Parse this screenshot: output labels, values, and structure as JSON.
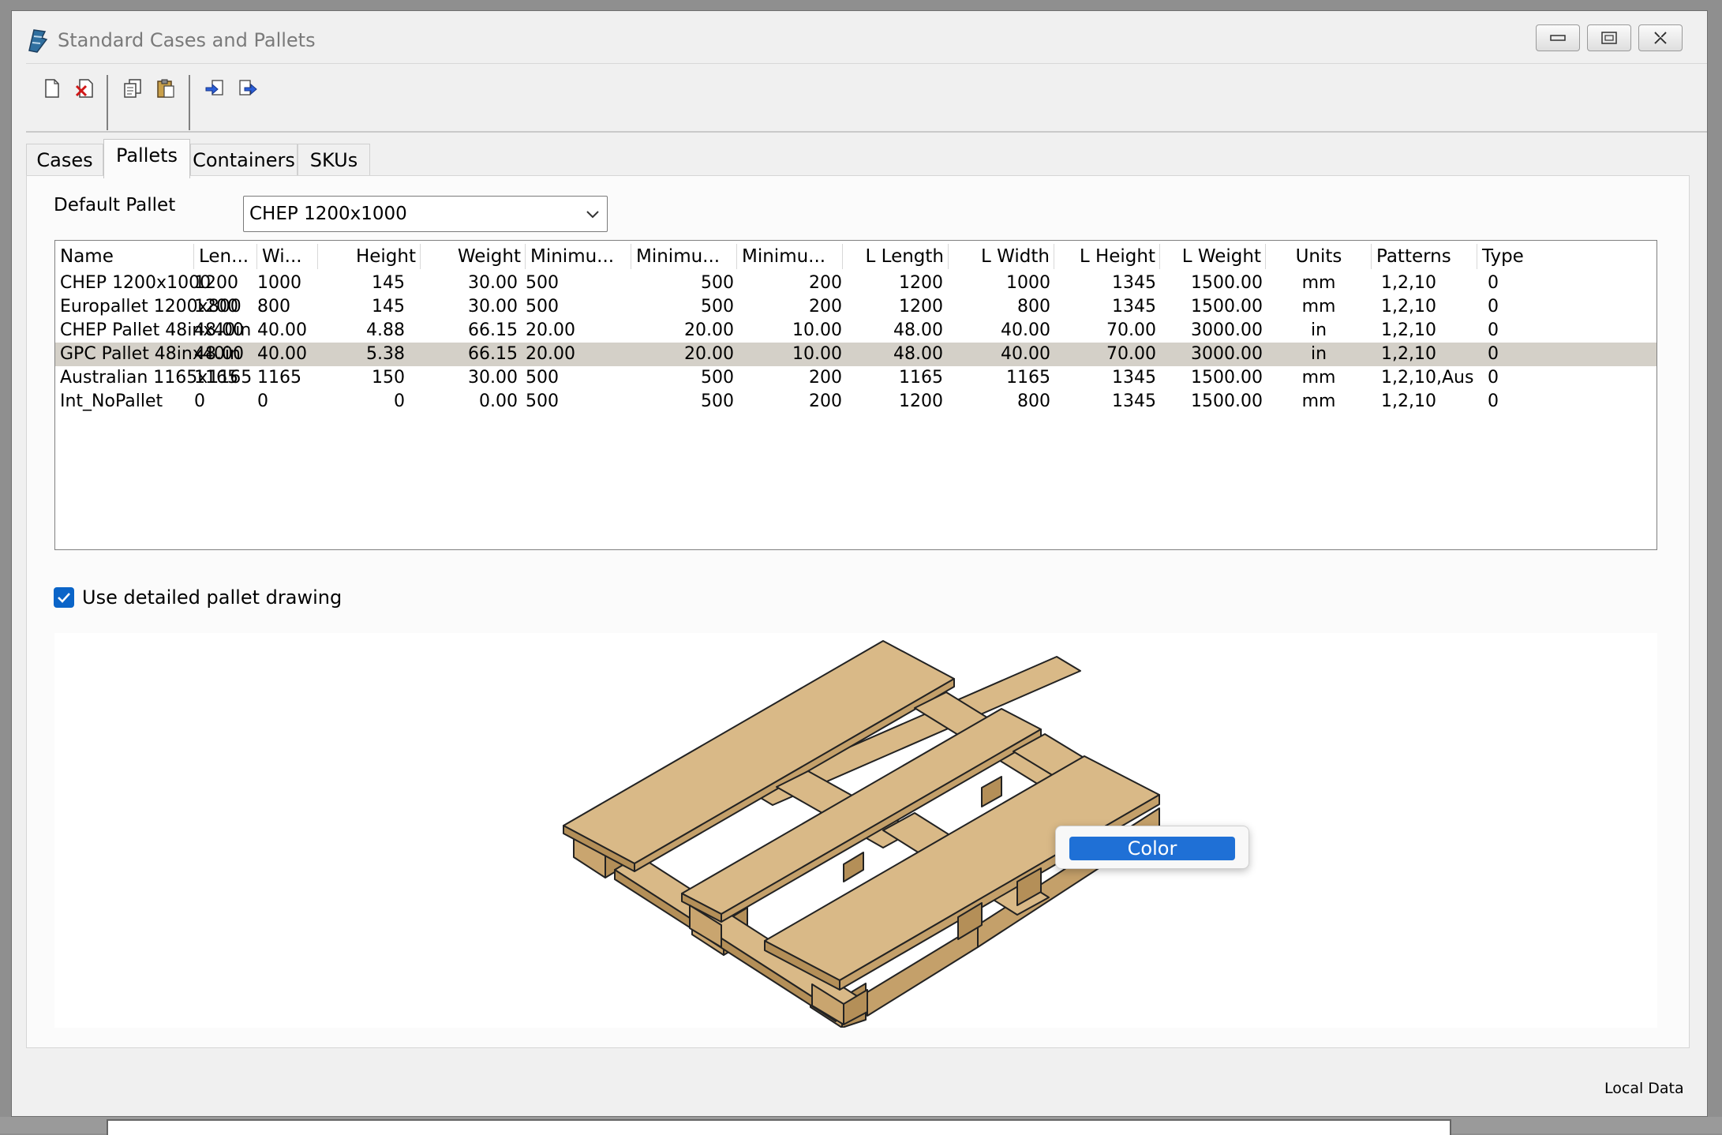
{
  "window": {
    "title": "Standard Cases and Pallets"
  },
  "toolbar": {
    "buttons": [
      {
        "name": "new-icon"
      },
      {
        "name": "delete-icon"
      },
      {
        "name": "copy-icon"
      },
      {
        "name": "paste-icon"
      },
      {
        "name": "import-icon"
      },
      {
        "name": "export-icon"
      }
    ]
  },
  "tabs": [
    {
      "label": "Cases"
    },
    {
      "label": "Pallets"
    },
    {
      "label": "Containers"
    },
    {
      "label": "SKUs"
    }
  ],
  "active_tab": "Pallets",
  "default_pallet": {
    "label": "Default Pallet",
    "value": "CHEP 1200x1000"
  },
  "table": {
    "columns": [
      "Name",
      "Len...",
      "Wi...",
      "Height",
      "Weight",
      "Minimu...",
      "Minimu...",
      "Minimu...",
      "L Length",
      "L Width",
      "L Height",
      "L Weight",
      "Units",
      "Patterns",
      "Type"
    ],
    "rows": [
      [
        "CHEP 1200x1000",
        "1200",
        "1000",
        "145",
        "30.00",
        "500",
        "500",
        "200",
        "1200",
        "1000",
        "1345",
        "1500.00",
        "mm",
        "1,2,10",
        "0"
      ],
      [
        "Europallet 1200x800",
        "1200",
        "800",
        "145",
        "30.00",
        "500",
        "500",
        "200",
        "1200",
        "800",
        "1345",
        "1500.00",
        "mm",
        "1,2,10",
        "0"
      ],
      [
        "CHEP Pallet 48inx40in",
        "48.00",
        "40.00",
        "4.88",
        "66.15",
        "20.00",
        "20.00",
        "10.00",
        "48.00",
        "40.00",
        "70.00",
        "3000.00",
        "in",
        "1,2,10",
        "0"
      ],
      [
        "GPC Pallet 48inx40in",
        "48.00",
        "40.00",
        "5.38",
        "66.15",
        "20.00",
        "20.00",
        "10.00",
        "48.00",
        "40.00",
        "70.00",
        "3000.00",
        "in",
        "1,2,10",
        "0"
      ],
      [
        "Australian 1165x1165",
        "1165",
        "1165",
        "150",
        "30.00",
        "500",
        "500",
        "200",
        "1165",
        "1165",
        "1345",
        "1500.00",
        "mm",
        "1,2,10,Aus",
        "0"
      ],
      [
        "Int_NoPallet",
        "0",
        "0",
        "0",
        "0.00",
        "500",
        "500",
        "200",
        "1200",
        "800",
        "1345",
        "1500.00",
        "mm",
        "1,2,10",
        "0"
      ]
    ],
    "selected_row": 3
  },
  "detailed_drawing": {
    "label": "Use detailed pallet drawing",
    "checked": true
  },
  "context_menu": {
    "items": [
      {
        "label": "Color"
      }
    ]
  },
  "status": {
    "text": "Local Data"
  },
  "colors": {
    "pallet_wood": "#d6b483",
    "selection": "#d4d0c8",
    "accent": "#1f70d6"
  }
}
